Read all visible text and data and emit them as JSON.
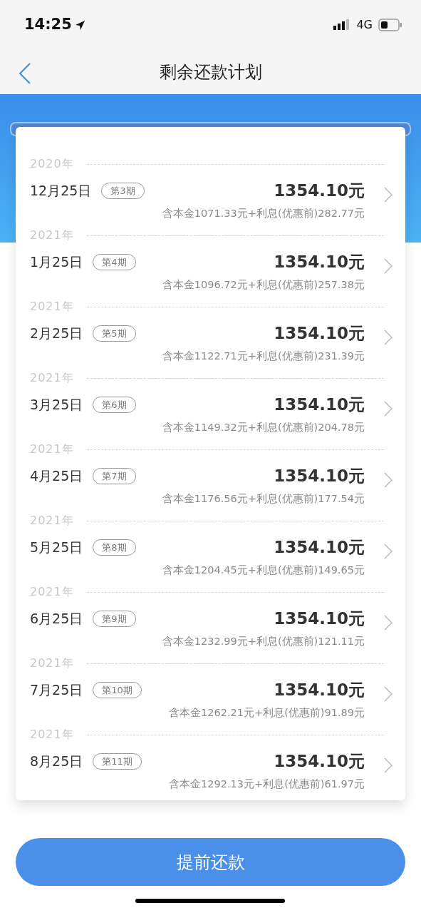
{
  "status_bar": {
    "time": "14:25",
    "network": "4G"
  },
  "nav": {
    "title": "剩余还款计划"
  },
  "installments": [
    {
      "year": "2020年",
      "date": "12月25日",
      "period": "第3期",
      "amount": "1354.10元",
      "detail": "含本金1071.33元+利息(优惠前)282.77元"
    },
    {
      "year": "2021年",
      "date": "1月25日",
      "period": "第4期",
      "amount": "1354.10元",
      "detail": "含本金1096.72元+利息(优惠前)257.38元"
    },
    {
      "year": "2021年",
      "date": "2月25日",
      "period": "第5期",
      "amount": "1354.10元",
      "detail": "含本金1122.71元+利息(优惠前)231.39元"
    },
    {
      "year": "2021年",
      "date": "3月25日",
      "period": "第6期",
      "amount": "1354.10元",
      "detail": "含本金1149.32元+利息(优惠前)204.78元"
    },
    {
      "year": "2021年",
      "date": "4月25日",
      "period": "第7期",
      "amount": "1354.10元",
      "detail": "含本金1176.56元+利息(优惠前)177.54元"
    },
    {
      "year": "2021年",
      "date": "5月25日",
      "period": "第8期",
      "amount": "1354.10元",
      "detail": "含本金1204.45元+利息(优惠前)149.65元"
    },
    {
      "year": "2021年",
      "date": "6月25日",
      "period": "第9期",
      "amount": "1354.10元",
      "detail": "含本金1232.99元+利息(优惠前)121.11元"
    },
    {
      "year": "2021年",
      "date": "7月25日",
      "period": "第10期",
      "amount": "1354.10元",
      "detail": "含本金1262.21元+利息(优惠前)91.89元"
    },
    {
      "year": "2021年",
      "date": "8月25日",
      "period": "第11期",
      "amount": "1354.10元",
      "detail": "含本金1292.13元+利息(优惠前)61.97元"
    }
  ],
  "action_button": "提前还款"
}
